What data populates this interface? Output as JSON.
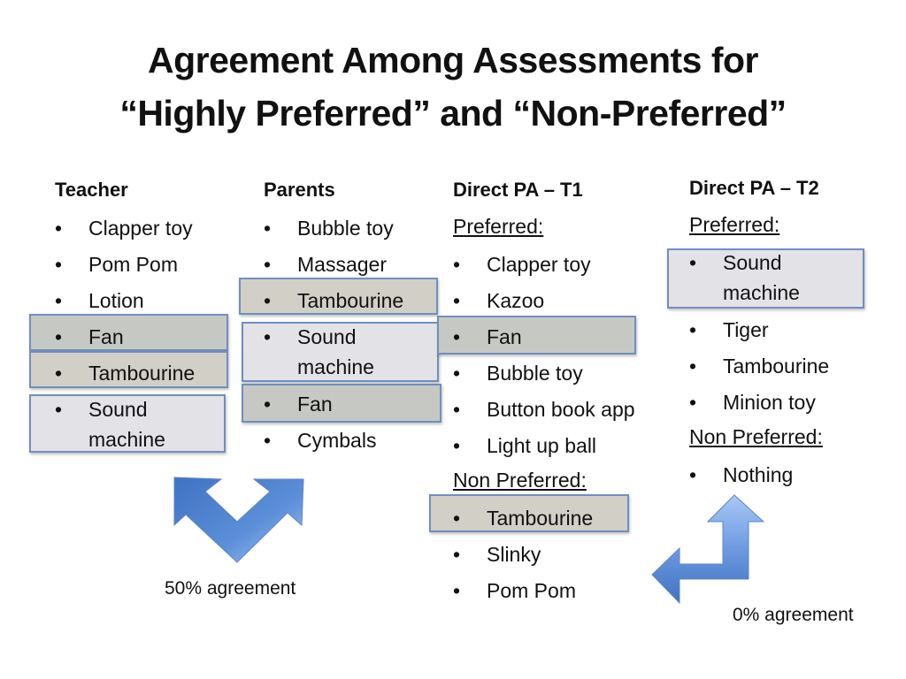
{
  "title_line1": "Agreement Among Assessments for",
  "title_line2": "“Highly Preferred” and “Non-Preferred”",
  "bullet": "•",
  "columns": {
    "teacher": {
      "header": "Teacher",
      "items": [
        "Clapper toy",
        "Pom Pom",
        "Lotion",
        "Fan",
        "Tambourine",
        "Sound machine"
      ]
    },
    "parents": {
      "header": "Parents",
      "items": [
        "Bubble toy",
        "Massager",
        "Tambourine",
        "Sound machine",
        "Fan",
        "Cymbals"
      ]
    },
    "t1": {
      "header": "Direct PA – T1",
      "preferred_label": "Preferred:",
      "preferred": [
        "Clapper toy",
        "Kazoo",
        "Fan",
        "Bubble toy",
        "Button book app",
        "Light up ball"
      ],
      "non_preferred_label": "Non Preferred:",
      "non_preferred": [
        "Tambourine",
        "Slinky",
        "Pom Pom"
      ]
    },
    "t2": {
      "header": "Direct PA – T2",
      "preferred_label": "Preferred:",
      "preferred": [
        "Sound machine",
        "Tiger",
        "Tambourine",
        "Minion toy"
      ],
      "non_preferred_label": "Non Preferred:",
      "non_preferred": [
        "Nothing"
      ]
    }
  },
  "agreement_left": "50% agreement",
  "agreement_right": "0% agreement",
  "colors": {
    "fan_highlight": "#c6c9c3",
    "tambourine_highlight": "#d1cfc6",
    "sound_machine_highlight": "#e3e2e6",
    "highlight_border": "#6f8fbf",
    "arrow_blue": "#4a7cc8"
  }
}
